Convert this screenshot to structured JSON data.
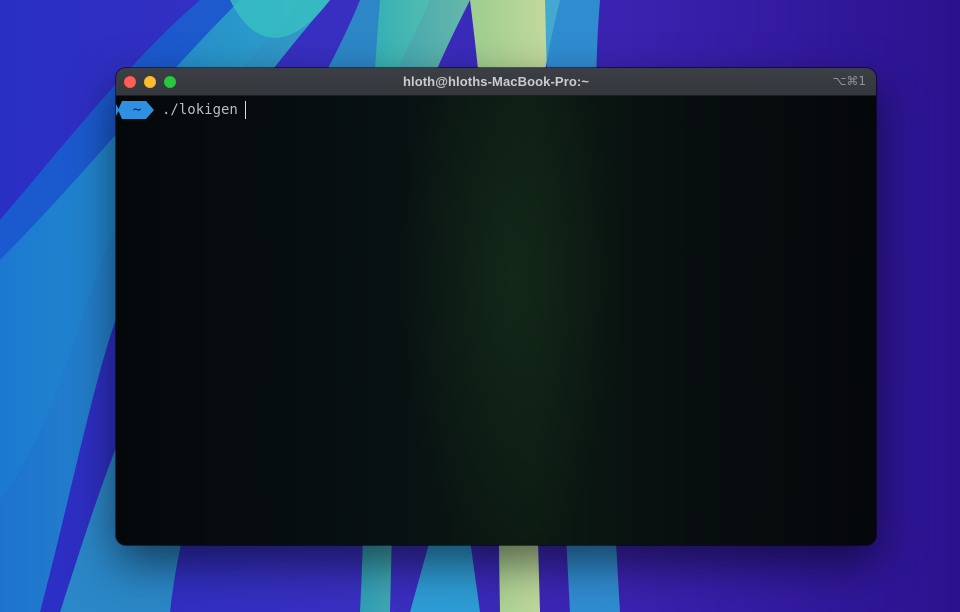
{
  "window": {
    "title": "hloth@hloths-MacBook-Pro:~",
    "shortcut": "⌥⌘1"
  },
  "terminal": {
    "prompt_dir": "~",
    "command": "./lokigen",
    "prompt_color": "#2f8fe0"
  },
  "colors": {
    "close": "#ff5f57",
    "minimize": "#febc2e",
    "zoom": "#28c840",
    "terminal_bg": "#05070a"
  }
}
